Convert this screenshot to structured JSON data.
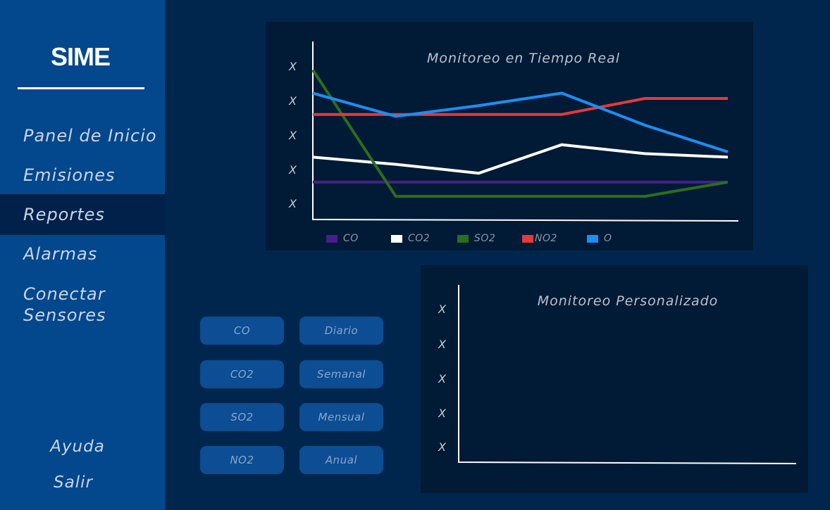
{
  "sidebar": {
    "brand": "SIME",
    "items": [
      {
        "label": "Panel de Inicio"
      },
      {
        "label": "Emisiones"
      },
      {
        "label": "Reportes"
      },
      {
        "label": "Alarmas"
      },
      {
        "label": "Conectar Sensores"
      }
    ],
    "help": "Ayuda",
    "exit": "Salir"
  },
  "filters": {
    "pollutants": [
      "CO",
      "CO2",
      "SO2",
      "NO2"
    ],
    "periods": [
      "Diario",
      "Semanal",
      "Mensual",
      "Anual"
    ]
  },
  "chart_data": [
    {
      "type": "line",
      "title": "Monitoreo en Tiempo Real",
      "y_tick_labels": [
        "X",
        "X",
        "X",
        "X",
        "X"
      ],
      "ylim": [
        0,
        100
      ],
      "grid": false,
      "legend_position": "bottom",
      "x": [
        0,
        1,
        2,
        3,
        4,
        5
      ],
      "series": [
        {
          "name": "CO",
          "color": "#4b1c8a",
          "values": [
            21,
            21,
            21,
            21,
            21,
            21
          ]
        },
        {
          "name": "CO2",
          "color": "#ffffff",
          "values": [
            35,
            31,
            26,
            42,
            37,
            35
          ]
        },
        {
          "name": "SO2",
          "color": "#2a6e1f",
          "values": [
            84,
            13,
            13,
            13,
            13,
            21
          ]
        },
        {
          "name": "NO2",
          "color": "#e53a3a",
          "values": [
            59,
            59,
            59,
            59,
            68,
            68
          ]
        },
        {
          "name": "O",
          "color": "#1a8ff5",
          "values": [
            71,
            58,
            64,
            71,
            53,
            38
          ]
        }
      ]
    },
    {
      "type": "line",
      "title": "Monitoreo Personalizado",
      "y_tick_labels": [
        "X",
        "X",
        "X",
        "X",
        "X"
      ],
      "grid": false,
      "series": []
    }
  ]
}
